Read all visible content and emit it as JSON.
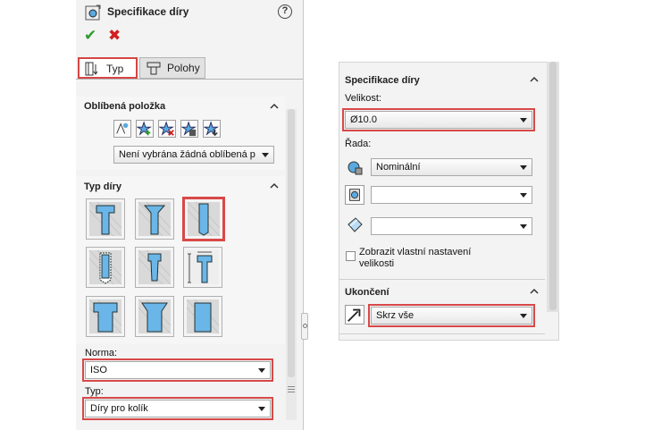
{
  "left": {
    "title": "Specifikace díry",
    "help_label": "?",
    "tabs": [
      {
        "label": "Typ",
        "active": true
      },
      {
        "label": "Polohy",
        "active": false
      }
    ],
    "favorite_section": {
      "title": "Oblíbená položka",
      "buttons": [
        "apply-defaults-icon",
        "add-favorite-icon",
        "delete-favorite-icon",
        "save-favorite-icon",
        "load-favorite-icon"
      ],
      "dropdown_value": "Není vybrána žádná oblíbená p"
    },
    "hole_type_section": {
      "title": "Typ díry",
      "types": [
        "counterbore",
        "countersink",
        "hole-selected",
        "straight-tap",
        "tapered-tap",
        "legacy-hole",
        "counterbore-slot",
        "countersink-slot",
        "straight-slot"
      ],
      "selected_index": 2
    },
    "standard": {
      "label": "Norma:",
      "value": "ISO"
    },
    "type": {
      "label": "Typ:",
      "value": "Díry pro kolík"
    }
  },
  "right": {
    "spec_section": {
      "title": "Specifikace díry",
      "size_label": "Velikost:",
      "size_value": "Ø10.0",
      "series_label": "Řada:",
      "fit_value": "Nominální",
      "custom_size_label": "Zobrazit vlastní nastavení velikosti"
    },
    "end_section": {
      "title": "Ukončení",
      "end_value": "Skrz vše"
    }
  },
  "colors": {
    "highlight": "#d94848",
    "ok": "#2f9a2f",
    "cancel": "#d02020",
    "icon_blue": "#5aa9e0"
  }
}
